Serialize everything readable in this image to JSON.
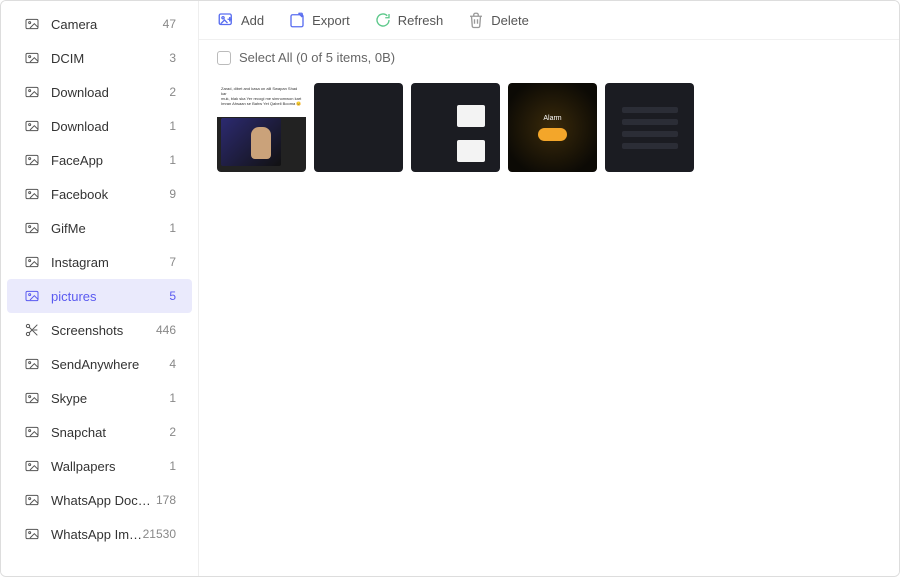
{
  "toolbar": {
    "add": "Add",
    "export": "Export",
    "refresh": "Refresh",
    "delete": "Delete"
  },
  "selectbar": {
    "text": "Select All (0 of 5 items, 0B)"
  },
  "sidebar": {
    "items": [
      {
        "label": "Camera",
        "count": "47",
        "icon": "image",
        "selected": false
      },
      {
        "label": "DCIM",
        "count": "3",
        "icon": "image",
        "selected": false
      },
      {
        "label": "Download",
        "count": "2",
        "icon": "image",
        "selected": false
      },
      {
        "label": "Download",
        "count": "1",
        "icon": "image",
        "selected": false
      },
      {
        "label": "FaceApp",
        "count": "1",
        "icon": "image",
        "selected": false
      },
      {
        "label": "Facebook",
        "count": "9",
        "icon": "image",
        "selected": false
      },
      {
        "label": "GifMe",
        "count": "1",
        "icon": "image",
        "selected": false
      },
      {
        "label": "Instagram",
        "count": "7",
        "icon": "image",
        "selected": false
      },
      {
        "label": "pictures",
        "count": "5",
        "icon": "image",
        "selected": true
      },
      {
        "label": "Screenshots",
        "count": "446",
        "icon": "scissors",
        "selected": false
      },
      {
        "label": "SendAnywhere",
        "count": "4",
        "icon": "image",
        "selected": false
      },
      {
        "label": "Skype",
        "count": "1",
        "icon": "image",
        "selected": false
      },
      {
        "label": "Snapchat",
        "count": "2",
        "icon": "image",
        "selected": false
      },
      {
        "label": "Wallpapers",
        "count": "1",
        "icon": "image",
        "selected": false
      },
      {
        "label": "WhatsApp Documents",
        "count": "178",
        "icon": "image",
        "selected": false
      },
      {
        "label": "WhatsApp Images",
        "count": "21530",
        "icon": "image",
        "selected": false
      }
    ]
  },
  "thumbnails": [
    {
      "kind": "meme-photo"
    },
    {
      "kind": "dark-list"
    },
    {
      "kind": "file-preview-grid"
    },
    {
      "kind": "alarm",
      "label": "Alarm"
    },
    {
      "kind": "settings-list"
    }
  ]
}
